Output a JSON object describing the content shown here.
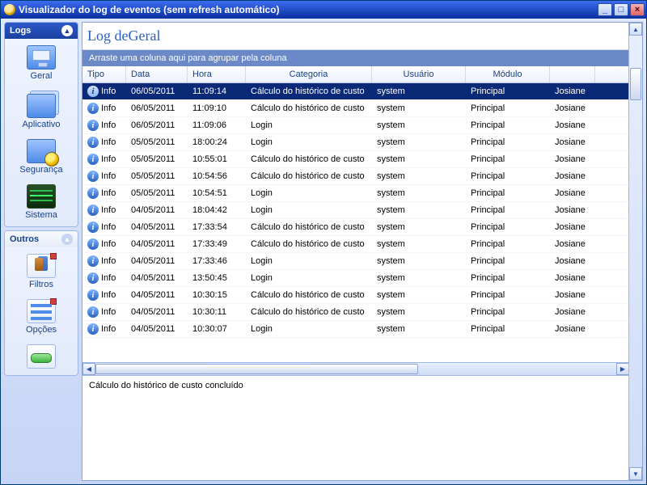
{
  "window": {
    "title": "Visualizador do log de eventos (sem refresh automático)"
  },
  "sidebar": {
    "panels": [
      {
        "title": "Logs",
        "items": [
          {
            "label": "Geral",
            "icon": "monitor"
          },
          {
            "label": "Aplicativo",
            "icon": "app"
          },
          {
            "label": "Segurança",
            "icon": "sec"
          },
          {
            "label": "Sistema",
            "icon": "sys"
          }
        ]
      },
      {
        "title": "Outros",
        "items": [
          {
            "label": "Filtros",
            "icon": "filter"
          },
          {
            "label": "Opções",
            "icon": "opt"
          },
          {
            "label": "",
            "icon": "green"
          }
        ]
      }
    ]
  },
  "main": {
    "title": "Log deGeral",
    "group_hint": "Arraste uma coluna aqui para agrupar pela coluna",
    "columns": [
      "Tipo",
      "Data",
      "Hora",
      "Categoria",
      "Usuário",
      "Módulo",
      ""
    ],
    "last_col_overflow": "Josiane",
    "rows": [
      {
        "tipo": "Info",
        "data": "06/05/2011",
        "hora": "11:09:14",
        "cat": "Cálculo do histórico de custo",
        "user": "system",
        "mod": "Principal",
        "sel": true
      },
      {
        "tipo": "Info",
        "data": "06/05/2011",
        "hora": "11:09:10",
        "cat": "Cálculo do histórico de custo",
        "user": "system",
        "mod": "Principal"
      },
      {
        "tipo": "Info",
        "data": "06/05/2011",
        "hora": "11:09:06",
        "cat": "Login",
        "user": "system",
        "mod": "Principal"
      },
      {
        "tipo": "Info",
        "data": "05/05/2011",
        "hora": "18:00:24",
        "cat": "Login",
        "user": "system",
        "mod": "Principal"
      },
      {
        "tipo": "Info",
        "data": "05/05/2011",
        "hora": "10:55:01",
        "cat": "Cálculo do histórico de custo",
        "user": "system",
        "mod": "Principal"
      },
      {
        "tipo": "Info",
        "data": "05/05/2011",
        "hora": "10:54:56",
        "cat": "Cálculo do histórico de custo",
        "user": "system",
        "mod": "Principal"
      },
      {
        "tipo": "Info",
        "data": "05/05/2011",
        "hora": "10:54:51",
        "cat": "Login",
        "user": "system",
        "mod": "Principal"
      },
      {
        "tipo": "Info",
        "data": "04/05/2011",
        "hora": "18:04:42",
        "cat": "Login",
        "user": "system",
        "mod": "Principal"
      },
      {
        "tipo": "Info",
        "data": "04/05/2011",
        "hora": "17:33:54",
        "cat": "Cálculo do histórico de custo",
        "user": "system",
        "mod": "Principal"
      },
      {
        "tipo": "Info",
        "data": "04/05/2011",
        "hora": "17:33:49",
        "cat": "Cálculo do histórico de custo",
        "user": "system",
        "mod": "Principal"
      },
      {
        "tipo": "Info",
        "data": "04/05/2011",
        "hora": "17:33:46",
        "cat": "Login",
        "user": "system",
        "mod": "Principal"
      },
      {
        "tipo": "Info",
        "data": "04/05/2011",
        "hora": "13:50:45",
        "cat": "Login",
        "user": "system",
        "mod": "Principal"
      },
      {
        "tipo": "Info",
        "data": "04/05/2011",
        "hora": "10:30:15",
        "cat": "Cálculo do histórico de custo",
        "user": "system",
        "mod": "Principal"
      },
      {
        "tipo": "Info",
        "data": "04/05/2011",
        "hora": "10:30:11",
        "cat": "Cálculo do histórico de custo",
        "user": "system",
        "mod": "Principal"
      },
      {
        "tipo": "Info",
        "data": "04/05/2011",
        "hora": "10:30:07",
        "cat": "Login",
        "user": "system",
        "mod": "Principal"
      }
    ],
    "detail": "Cálculo do histórico de custo concluído"
  }
}
